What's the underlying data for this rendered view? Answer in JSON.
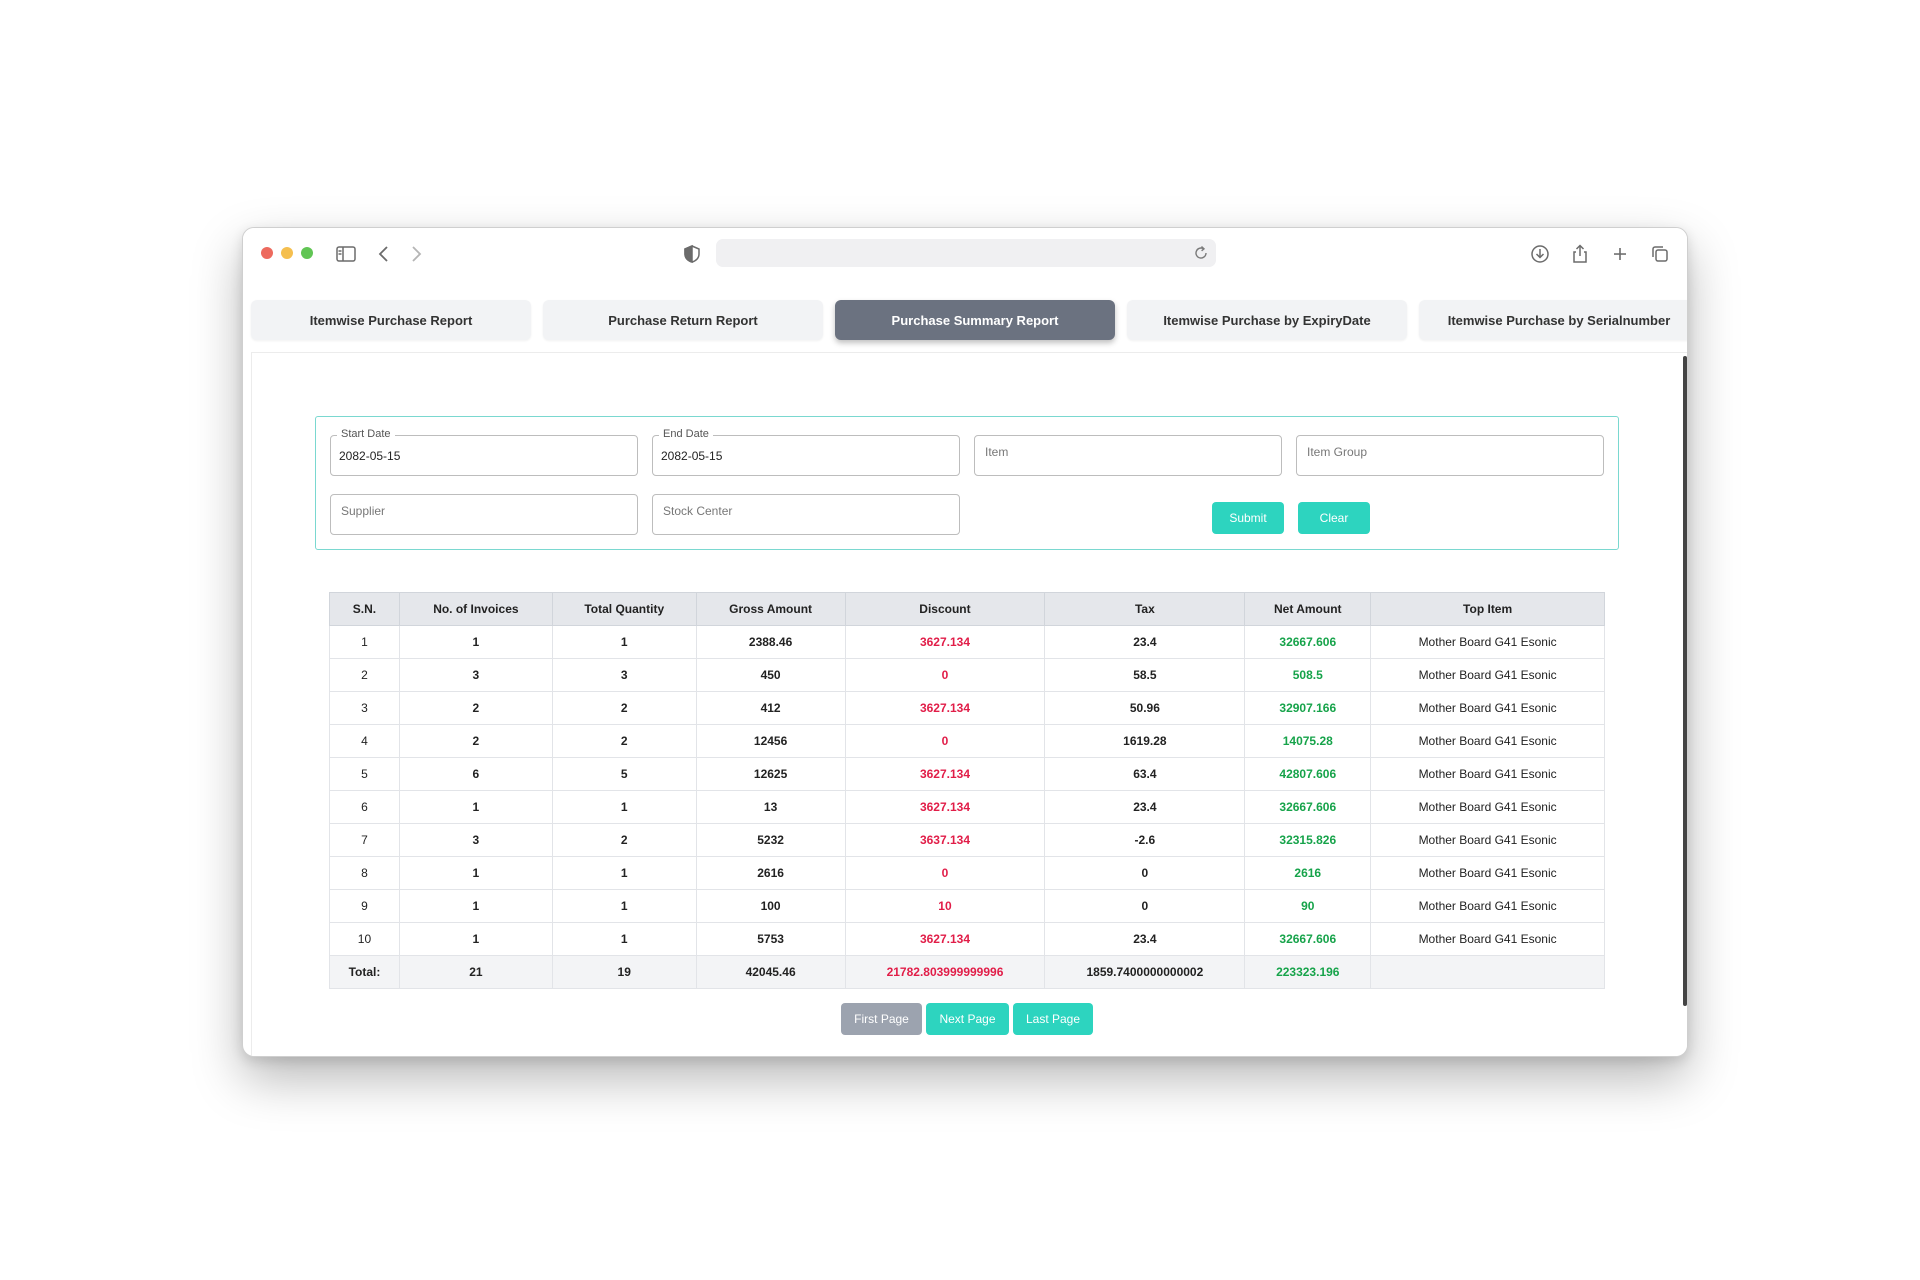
{
  "tabs": [
    {
      "label": "Itemwise Purchase Report",
      "active": false
    },
    {
      "label": "Purchase Return Report",
      "active": false
    },
    {
      "label": "Purchase Summary Report",
      "active": true
    },
    {
      "label": "Itemwise Purchase by ExpiryDate",
      "active": false
    },
    {
      "label": "Itemwise Purchase by Serialnumber",
      "active": false
    }
  ],
  "filters": {
    "start_date": {
      "label": "Start Date",
      "value": "2082-05-15"
    },
    "end_date": {
      "label": "End Date",
      "value": "2082-05-15"
    },
    "item": {
      "placeholder": "Item"
    },
    "item_group": {
      "placeholder": "Item Group"
    },
    "supplier": {
      "placeholder": "Supplier"
    },
    "stock_center": {
      "placeholder": "Stock Center"
    },
    "submit_label": "Submit",
    "clear_label": "Clear"
  },
  "table": {
    "headers": [
      "S.N.",
      "No. of Invoices",
      "Total Quantity",
      "Gross Amount",
      "Discount",
      "Tax",
      "Net Amount",
      "Top Item"
    ],
    "rows": [
      [
        "1",
        "1",
        "1",
        "2388.46",
        "3627.134",
        "23.4",
        "32667.606",
        "Mother Board G41 Esonic"
      ],
      [
        "2",
        "3",
        "3",
        "450",
        "0",
        "58.5",
        "508.5",
        "Mother Board G41 Esonic"
      ],
      [
        "3",
        "2",
        "2",
        "412",
        "3627.134",
        "50.96",
        "32907.166",
        "Mother Board G41 Esonic"
      ],
      [
        "4",
        "2",
        "2",
        "12456",
        "0",
        "1619.28",
        "14075.28",
        "Mother Board G41 Esonic"
      ],
      [
        "5",
        "6",
        "5",
        "12625",
        "3627.134",
        "63.4",
        "42807.606",
        "Mother Board G41 Esonic"
      ],
      [
        "6",
        "1",
        "1",
        "13",
        "3627.134",
        "23.4",
        "32667.606",
        "Mother Board G41 Esonic"
      ],
      [
        "7",
        "3",
        "2",
        "5232",
        "3637.134",
        "-2.6",
        "32315.826",
        "Mother Board G41 Esonic"
      ],
      [
        "8",
        "1",
        "1",
        "2616",
        "0",
        "0",
        "2616",
        "Mother Board G41 Esonic"
      ],
      [
        "9",
        "1",
        "1",
        "100",
        "10",
        "0",
        "90",
        "Mother Board G41 Esonic"
      ],
      [
        "10",
        "1",
        "1",
        "5753",
        "3627.134",
        "23.4",
        "32667.606",
        "Mother Board G41 Esonic"
      ]
    ],
    "total": [
      "Total:",
      "21",
      "19",
      "42045.46",
      "21782.803999999996",
      "1859.7400000000002",
      "223323.196",
      ""
    ]
  },
  "pagination": {
    "first_label": "First Page",
    "next_label": "Next Page",
    "last_label": "Last Page"
  },
  "colors": {
    "accent": "#2dd4bf",
    "active_tab": "#6b7280",
    "discount": "#e11d48",
    "net_amount": "#16a34a"
  },
  "icons": [
    "sidebar-icon",
    "back-icon",
    "forward-icon",
    "shield-icon",
    "reload-icon",
    "download-icon",
    "share-icon",
    "new-tab-icon",
    "tabs-overview-icon"
  ]
}
